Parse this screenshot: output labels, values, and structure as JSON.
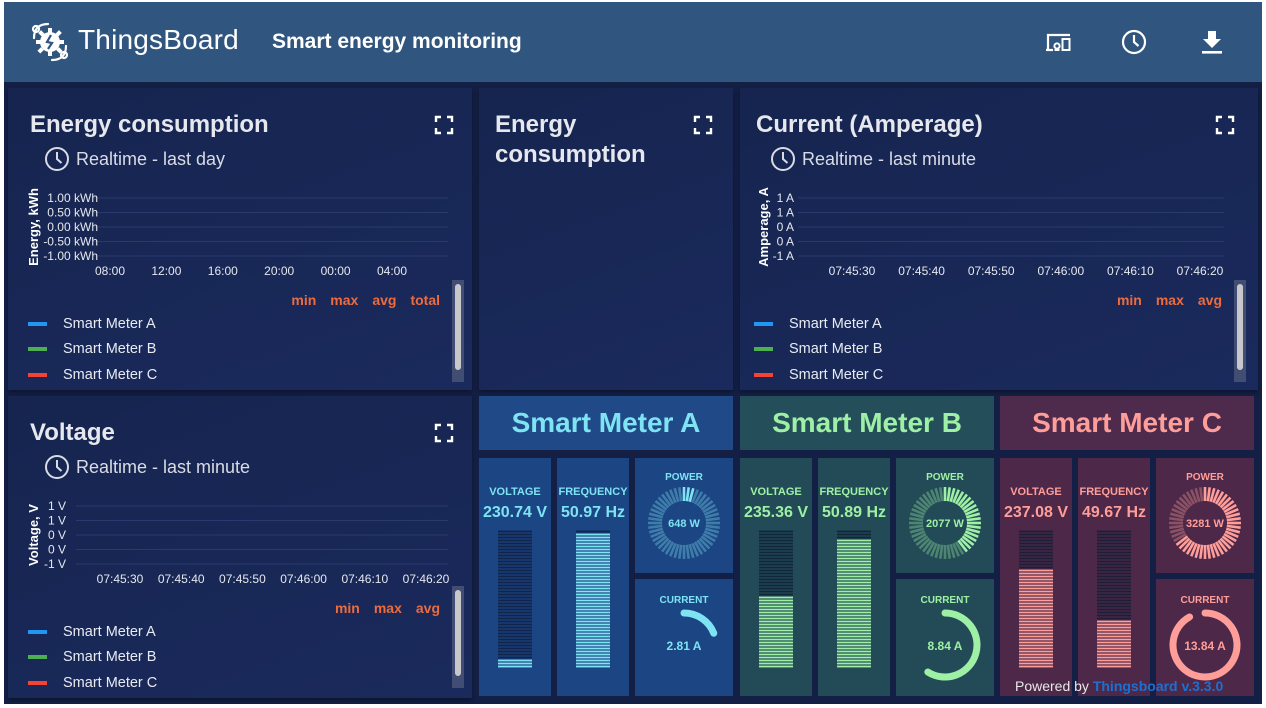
{
  "header": {
    "brand": "ThingsBoard",
    "dashboard_title": "Smart energy monitoring",
    "buttons": [
      {
        "name": "entity-view-button",
        "icon": "devices-icon"
      },
      {
        "name": "timewindow-button",
        "icon": "clock-icon"
      },
      {
        "name": "export-button",
        "icon": "download-icon"
      }
    ]
  },
  "colors": {
    "meter_a": "#2196f3",
    "meter_b": "#4caf50",
    "meter_c": "#f44336",
    "legend_header": "#ef6b3c",
    "link": "#1e6fd0"
  },
  "widgets": {
    "energy": {
      "title": "Energy consumption",
      "timewindow": "Realtime - last day",
      "legend_headers": [
        "min",
        "max",
        "avg",
        "total"
      ],
      "series": [
        "Smart Meter A",
        "Smart Meter B",
        "Smart Meter C"
      ]
    },
    "energy_total": {
      "title_line1": "Energy",
      "title_line2": "consumption"
    },
    "current": {
      "title": "Current (Amperage)",
      "timewindow": "Realtime - last minute",
      "legend_headers": [
        "min",
        "max",
        "avg"
      ],
      "series": [
        "Smart Meter A",
        "Smart Meter B",
        "Smart Meter C"
      ]
    },
    "voltage": {
      "title": "Voltage",
      "timewindow": "Realtime - last minute",
      "legend_headers": [
        "min",
        "max",
        "avg"
      ],
      "series": [
        "Smart Meter A",
        "Smart Meter B",
        "Smart Meter C"
      ]
    }
  },
  "chart_data": [
    {
      "type": "line",
      "title": "Energy consumption",
      "ylabel": "Energy, kWh",
      "yticks": [
        "1.00 kWh",
        "0.50 kWh",
        "0.00 kWh",
        "-0.50 kWh",
        "-1.00 kWh"
      ],
      "ylim": [
        -1,
        1
      ],
      "xticks": [
        "08:00",
        "12:00",
        "16:00",
        "20:00",
        "00:00",
        "04:00"
      ],
      "grid": true,
      "series": [
        {
          "name": "Smart Meter A",
          "values": []
        },
        {
          "name": "Smart Meter B",
          "values": []
        },
        {
          "name": "Smart Meter C",
          "values": []
        }
      ]
    },
    {
      "type": "line",
      "title": "Current (Amperage)",
      "ylabel": "Amperage, A",
      "yticks": [
        "1 A",
        "1 A",
        "0 A",
        "0 A",
        "-1 A"
      ],
      "ylim": [
        -1,
        1
      ],
      "xticks": [
        "07:45:30",
        "07:45:40",
        "07:45:50",
        "07:46:00",
        "07:46:10",
        "07:46:20"
      ],
      "grid": true,
      "series": [
        {
          "name": "Smart Meter A",
          "values": []
        },
        {
          "name": "Smart Meter B",
          "values": []
        },
        {
          "name": "Smart Meter C",
          "values": []
        }
      ]
    },
    {
      "type": "line",
      "title": "Voltage",
      "ylabel": "Voltage, V",
      "yticks": [
        "1 V",
        "1 V",
        "0 V",
        "0 V",
        "-1 V"
      ],
      "ylim": [
        -1,
        1
      ],
      "xticks": [
        "07:45:30",
        "07:45:40",
        "07:45:50",
        "07:46:00",
        "07:46:10",
        "07:46:20"
      ],
      "grid": true,
      "series": [
        {
          "name": "Smart Meter A",
          "values": []
        },
        {
          "name": "Smart Meter B",
          "values": []
        },
        {
          "name": "Smart Meter C",
          "values": []
        }
      ]
    }
  ],
  "meters": [
    {
      "name": "Smart Meter A",
      "theme": {
        "head_bg": "#1f4a87",
        "tile_bg": "#1c4583",
        "accent": "#7ee3f2",
        "dim": "#11244a"
      },
      "voltage_label": "VOLTAGE",
      "voltage": "230.74 V",
      "voltage_fill": 0.06,
      "frequency_label": "FREQUENCY",
      "frequency": "50.97 Hz",
      "frequency_fill": 0.98,
      "power_label": "POWER",
      "power": "648 W",
      "power_fill": 0.06,
      "current_label": "CURRENT",
      "current": "2.81 A",
      "current_fill": 0.19
    },
    {
      "name": "Smart Meter B",
      "theme": {
        "head_bg": "#244e5a",
        "tile_bg": "#234b57",
        "accent": "#9ef0a4",
        "dim": "#11263a"
      },
      "voltage_label": "VOLTAGE",
      "voltage": "235.36 V",
      "voltage_fill": 0.53,
      "frequency_label": "FREQUENCY",
      "frequency": "50.89 Hz",
      "frequency_fill": 0.94,
      "power_label": "POWER",
      "power": "2077 W",
      "power_fill": 0.42,
      "current_label": "CURRENT",
      "current": "8.84 A",
      "current_fill": 0.59
    },
    {
      "name": "Smart Meter C",
      "theme": {
        "head_bg": "#4e2a4c",
        "tile_bg": "#4d2848",
        "accent": "#ff9e98",
        "dim": "#1c1e3a"
      },
      "voltage_label": "VOLTAGE",
      "voltage": "237.08 V",
      "voltage_fill": 0.71,
      "frequency_label": "FREQUENCY",
      "frequency": "49.67 Hz",
      "frequency_fill": 0.34,
      "power_label": "POWER",
      "power": "3281 W",
      "power_fill": 0.66,
      "current_label": "CURRENT",
      "current": "13.84 A",
      "current_fill": 0.92
    }
  ],
  "footer": {
    "powered_by": "Powered by",
    "link_text": "Thingsboard v.3.3.0"
  }
}
